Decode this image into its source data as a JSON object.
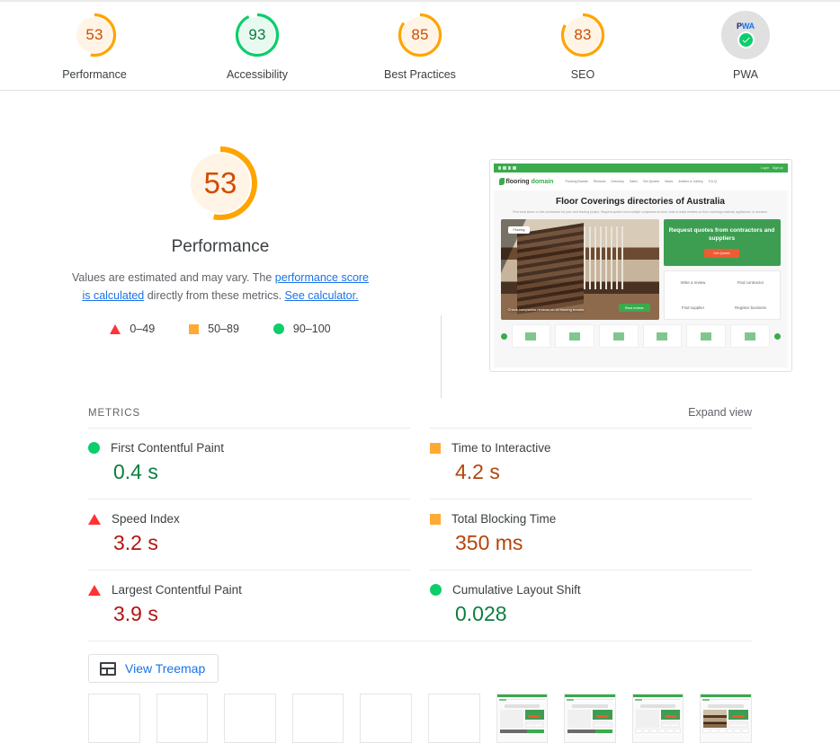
{
  "scores_bar": {
    "items": [
      {
        "label": "Performance",
        "value": "53",
        "color": "#ffa400",
        "bg": "#fff4e5",
        "text_color": "#d04c04",
        "percent": 53
      },
      {
        "label": "Accessibility",
        "value": "93",
        "color": "#0cce6b",
        "bg": "#e8faf0",
        "text_color": "#0b7c3f",
        "percent": 93
      },
      {
        "label": "Best Practices",
        "value": "85",
        "color": "#ffa400",
        "bg": "#fff4e5",
        "text_color": "#d04c04",
        "percent": 85
      },
      {
        "label": "SEO",
        "value": "83",
        "color": "#ffa400",
        "bg": "#fff4e5",
        "text_color": "#d04c04",
        "percent": 83
      }
    ],
    "pwa": {
      "label": "PWA",
      "badge_text_p": "P",
      "badge_text_wa": "WA",
      "check_icon": "check-icon"
    }
  },
  "performance": {
    "score": "53",
    "title": "Performance",
    "percent": 53,
    "arc_color": "#ffa400",
    "arc_bg": "#fff4e5",
    "score_color": "#d04c04",
    "description_part1": "Values are estimated and may vary. The ",
    "link_calculated": "performance score is calculated",
    "description_part2": " directly from these metrics. ",
    "link_calculator": "See calculator.",
    "legend": [
      {
        "icon": "triangle-fail-icon",
        "range": "0–49"
      },
      {
        "icon": "square-average-icon",
        "range": "50–89"
      },
      {
        "icon": "circle-pass-icon",
        "range": "90–100"
      }
    ]
  },
  "site_preview": {
    "topbar": {
      "login": "Log In",
      "signup": "Sign Up"
    },
    "logo_bold": "flooring",
    "logo_green": "domain",
    "nav": [
      "Flooring Brands",
      "Reviews",
      "Directory",
      "Sales",
      "Get Quotes",
      "News",
      "Articles & Gallery",
      "F.A.Q."
    ],
    "headline": "Floor Coverings directories of Australia",
    "subhead": "Find local stores or hire contractors for your next flooring project. Request quotes from multiple companies at once, read or leave reviews on floor coverings material, appliances, or services.",
    "photo_tag": "Flooring",
    "photo_caption": "Check companies reviews on all flooring brands",
    "photo_button": "Read reviews",
    "quote_title": "Request quotes from contractors and suppliers",
    "quote_button": "Get Quotes",
    "links": [
      "Write a review",
      "Find contractor",
      "Find supplier",
      "Register business"
    ]
  },
  "metrics": {
    "heading": "METRICS",
    "expand_view": "Expand view",
    "items": [
      {
        "icon": "circle-pass-icon",
        "name": "First Contentful Paint",
        "value": "0.4 s",
        "value_class": "v-green",
        "marker": "m-cir"
      },
      {
        "icon": "square-average-icon",
        "name": "Time to Interactive",
        "value": "4.2 s",
        "value_class": "v-orange",
        "marker": "m-sq"
      },
      {
        "icon": "triangle-fail-icon",
        "name": "Speed Index",
        "value": "3.2 s",
        "value_class": "v-red",
        "marker": "m-tri"
      },
      {
        "icon": "square-average-icon",
        "name": "Total Blocking Time",
        "value": "350 ms",
        "value_class": "v-orange",
        "marker": "m-sq"
      },
      {
        "icon": "triangle-fail-icon",
        "name": "Largest Contentful Paint",
        "value": "3.9 s",
        "value_class": "v-red",
        "marker": "m-tri"
      },
      {
        "icon": "circle-pass-icon",
        "name": "Cumulative Layout Shift",
        "value": "0.028",
        "value_class": "v-green",
        "marker": "m-cir"
      }
    ]
  },
  "treemap": {
    "label": "View Treemap",
    "icon": "treemap-icon"
  },
  "filmstrip": {
    "frames": [
      "blank",
      "blank",
      "blank",
      "blank",
      "blank",
      "blank",
      "partial",
      "partial",
      "partial",
      "loaded"
    ]
  }
}
